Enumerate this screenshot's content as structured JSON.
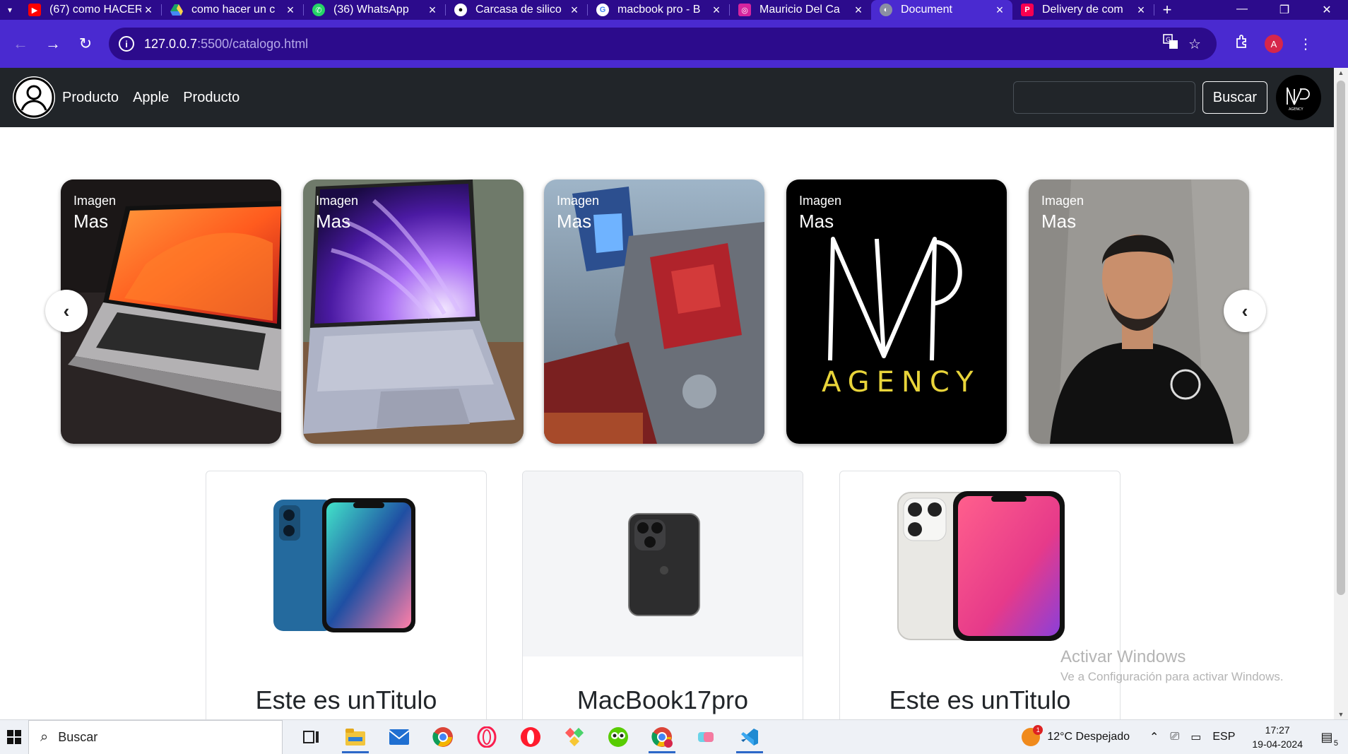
{
  "tabs": [
    {
      "title": "(67) como HACER",
      "favicon_color": "#ff0000",
      "favicon": "youtube-icon"
    },
    {
      "title": "como hacer un c",
      "favicon_color": "#1fa463",
      "favicon": "drive-icon"
    },
    {
      "title": "(36) WhatsApp",
      "favicon_color": "#25d366",
      "favicon": "whatsapp-icon"
    },
    {
      "title": "Carcasa de silico",
      "favicon_color": "#ffffff",
      "favicon": "apple-icon"
    },
    {
      "title": "macbook pro - B",
      "favicon_color": "#4285f4",
      "favicon": "google-icon"
    },
    {
      "title": "Mauricio Del Ca",
      "favicon_color": "#d6249f",
      "favicon": "instagram-icon"
    },
    {
      "title": "Document",
      "favicon_color": "#8a8fa3",
      "favicon": "globe-icon",
      "active": true
    },
    {
      "title": "Delivery de com",
      "favicon_color": "#fa0050",
      "favicon": "pedidosya-icon"
    }
  ],
  "tab_close_glyph": "×",
  "new_tab_glyph": "+",
  "window_controls": {
    "minimize": "—",
    "restore": "❐",
    "close": "✕"
  },
  "address": {
    "host": "127.0.0.7",
    "path": ":5500/catalogo.html",
    "info_glyph": "i"
  },
  "profile_initial": "A",
  "site": {
    "nav_links": [
      "Producto",
      "Apple",
      "Producto"
    ],
    "search_value": "",
    "search_button": "Buscar",
    "brand_logo_text": "AGENCY"
  },
  "carousel": {
    "cards": [
      {
        "caption_small": "Imagen",
        "caption_big": "Mas",
        "subject": "laptop-orange"
      },
      {
        "caption_small": "Imagen",
        "caption_big": "Mas",
        "subject": "laptop-purple"
      },
      {
        "caption_small": "Imagen",
        "caption_big": "Mas",
        "subject": "robot"
      },
      {
        "caption_small": "Imagen",
        "caption_big": "Mas",
        "subject": "agency-logo"
      },
      {
        "caption_small": "Imagen",
        "caption_big": "Mas",
        "subject": "man-portrait"
      }
    ],
    "agency_text": "AGENCY",
    "prev_glyph": "‹",
    "next_glyph": "‹"
  },
  "products": [
    {
      "title": "Este es unTitulo"
    },
    {
      "title": "MacBook17pro"
    },
    {
      "title": "Este es unTitulo"
    }
  ],
  "watermark": {
    "line1": "Activar Windows",
    "line2": "Ve a Configuración para activar Windows."
  },
  "taskbar": {
    "search_placeholder": "Buscar",
    "weather": "12°C  Despejado",
    "weather_badge": "1",
    "lang": "ESP",
    "time": "17:27",
    "date": "19-04-2024",
    "notif_count": "5"
  }
}
